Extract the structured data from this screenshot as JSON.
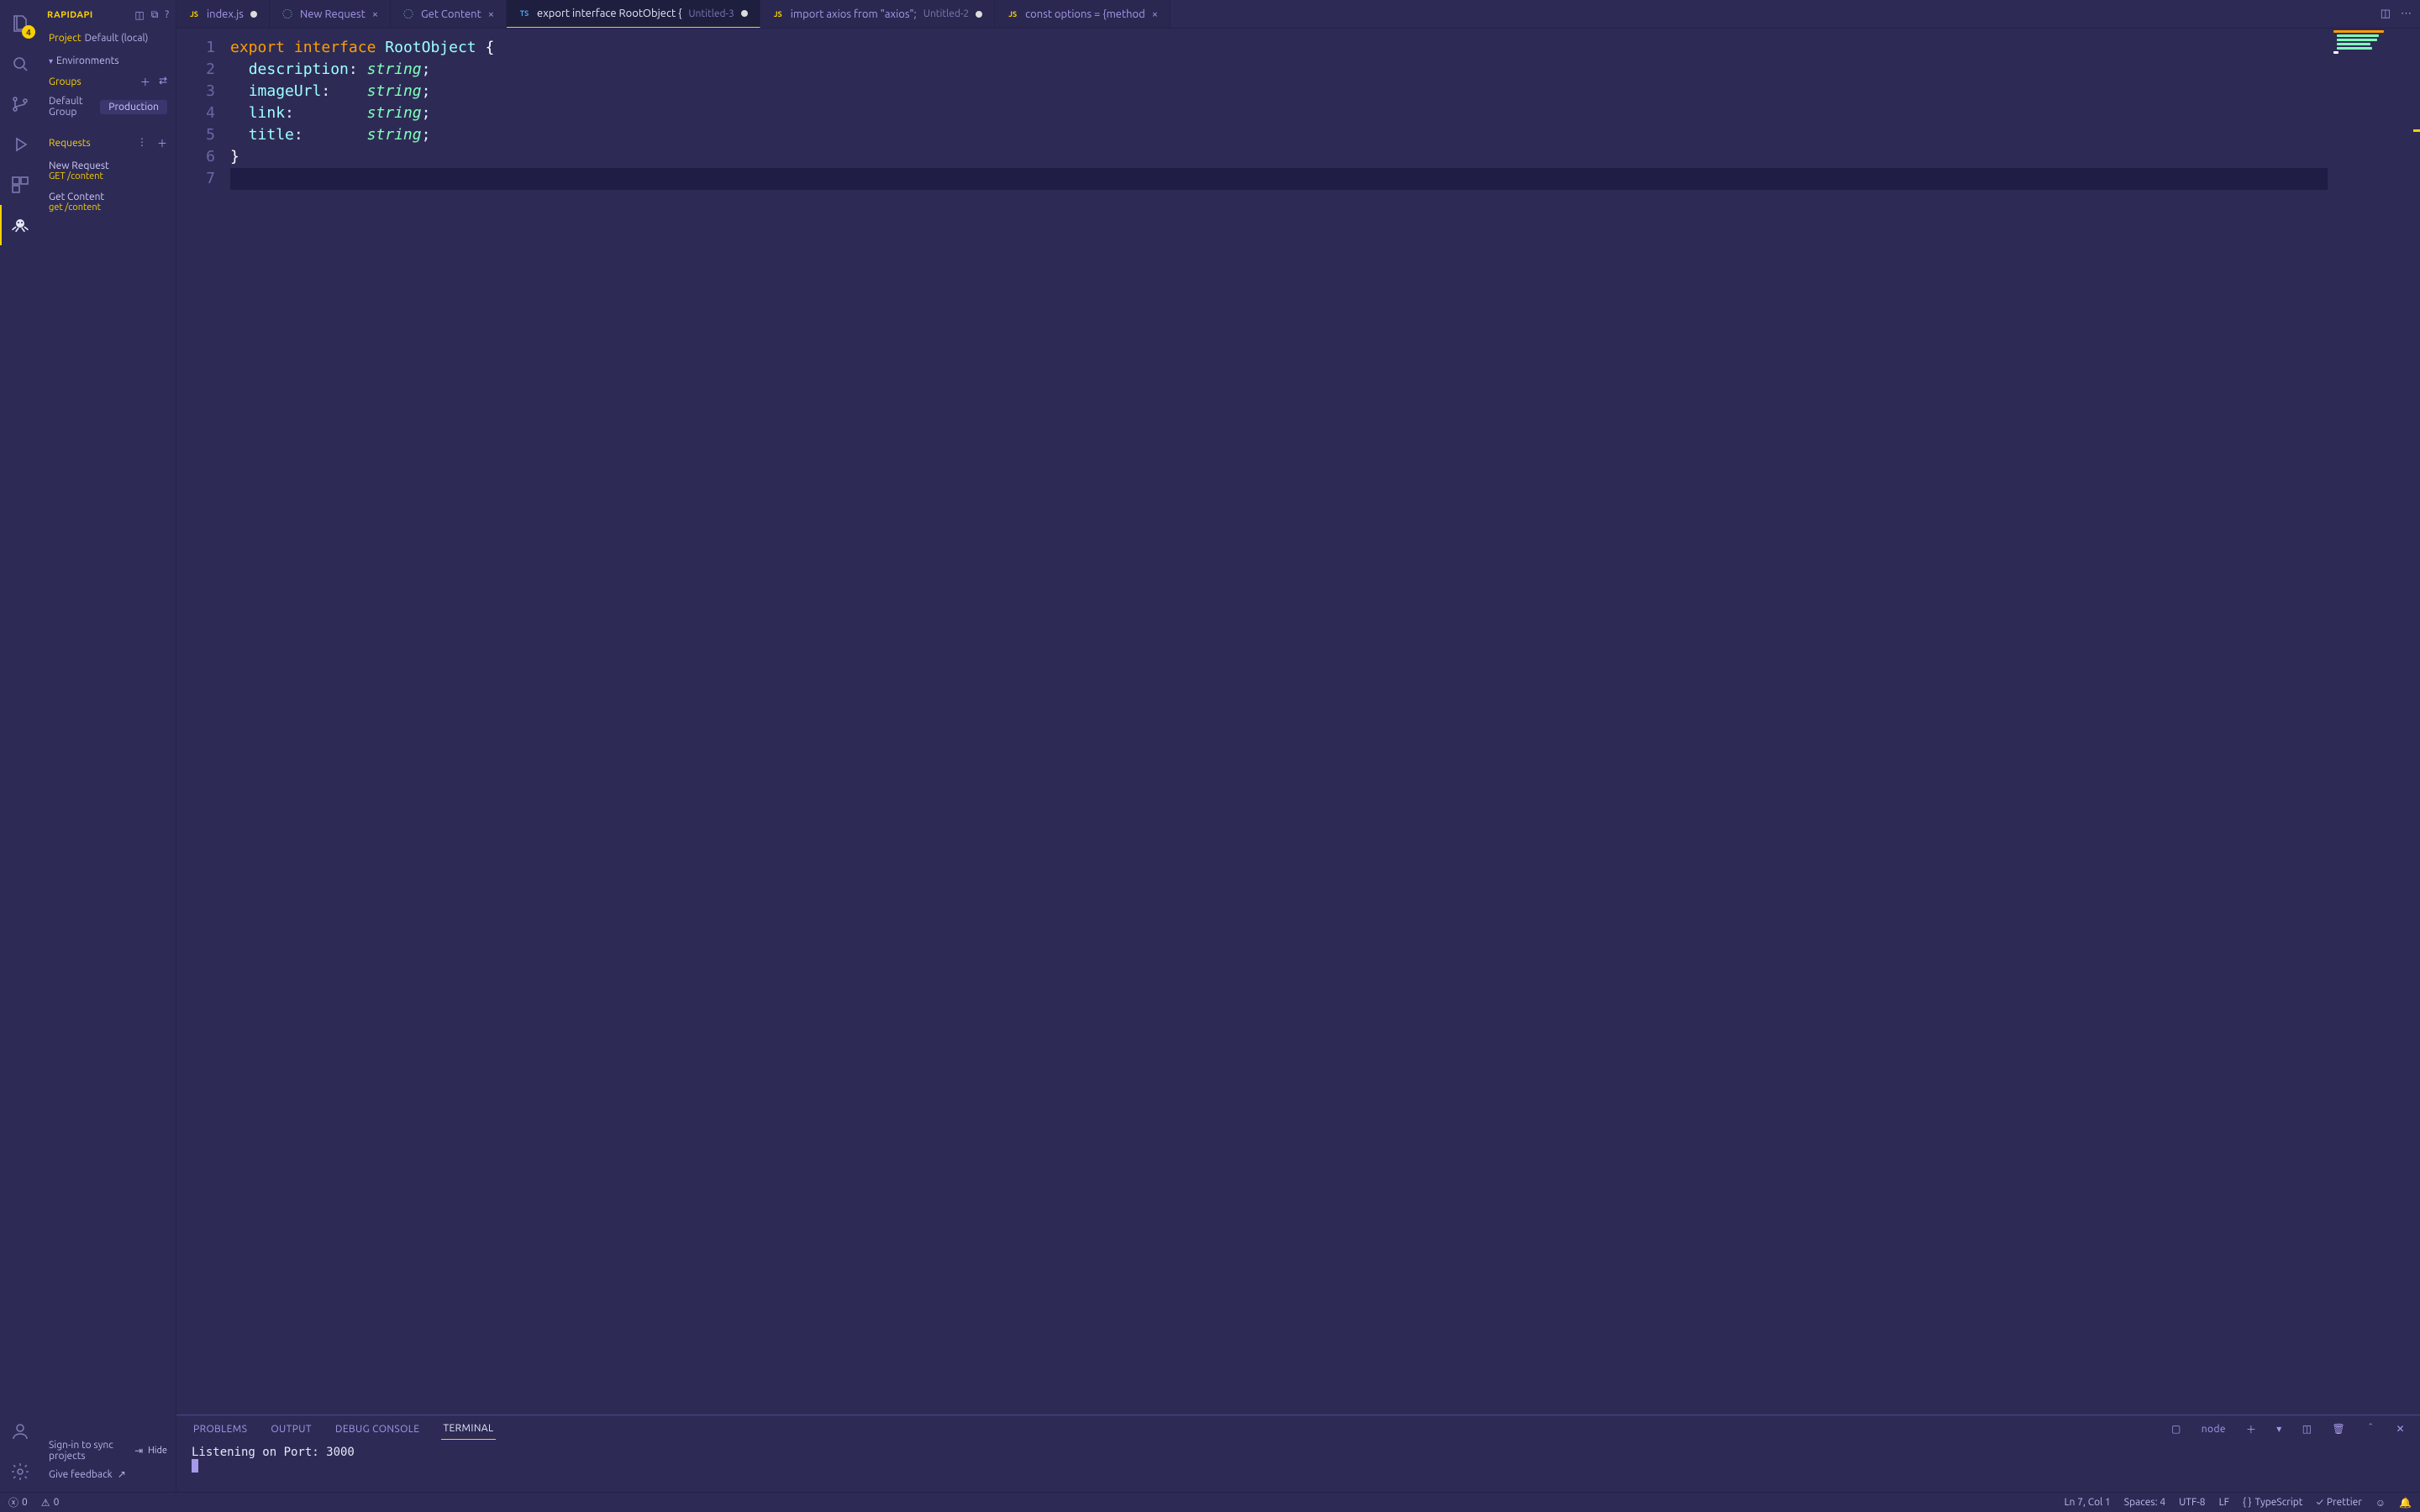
{
  "sidebar": {
    "title": "RAPIDAPI",
    "project_label": "Project",
    "project_name": "Default (local)",
    "environments_label": "Environments",
    "groups_label": "Groups",
    "default_group_label": "Default Group",
    "env_chip": "Production",
    "requests_label": "Requests",
    "requests": [
      {
        "name": "New Request",
        "sub": "GET /content"
      },
      {
        "name": "Get Content",
        "sub": "get /content"
      }
    ],
    "signin_text": "Sign-in to sync projects",
    "hide_label": "Hide",
    "feedback_label": "Give feedback"
  },
  "activity_badge": "4",
  "tabs": [
    {
      "kind": "js",
      "label": "index.js",
      "desc": "",
      "dirty": true
    },
    {
      "kind": "api",
      "label": "New Request",
      "desc": "",
      "dirty": false
    },
    {
      "kind": "api",
      "label": "Get Content",
      "desc": "",
      "dirty": false
    },
    {
      "kind": "ts",
      "label": "export interface RootObject {",
      "desc": "Untitled-3",
      "dirty": true,
      "active": true
    },
    {
      "kind": "js",
      "label": "import axios from \"axios\";",
      "desc": "Untitled-2",
      "dirty": true
    },
    {
      "kind": "js",
      "label": "const options = {method",
      "desc": "",
      "dirty": false
    }
  ],
  "code": {
    "lines": [
      {
        "n": 1,
        "tokens": [
          [
            "kw-export",
            "export"
          ],
          [
            "",
            " "
          ],
          [
            "kw-interface",
            "interface"
          ],
          [
            "",
            " "
          ],
          [
            "typename",
            "RootObject"
          ],
          [
            "",
            " "
          ],
          [
            "brace",
            "{"
          ]
        ]
      },
      {
        "n": 2,
        "tokens": [
          [
            "",
            "  "
          ],
          [
            "prop",
            "description"
          ],
          [
            "colon",
            ":"
          ],
          [
            "",
            " "
          ],
          [
            "type",
            "string"
          ],
          [
            "semi",
            ";"
          ]
        ]
      },
      {
        "n": 3,
        "tokens": [
          [
            "",
            "  "
          ],
          [
            "prop",
            "imageUrl"
          ],
          [
            "colon",
            ":"
          ],
          [
            "",
            "    "
          ],
          [
            "type",
            "string"
          ],
          [
            "semi",
            ";"
          ]
        ]
      },
      {
        "n": 4,
        "tokens": [
          [
            "",
            "  "
          ],
          [
            "prop",
            "link"
          ],
          [
            "colon",
            ":"
          ],
          [
            "",
            "        "
          ],
          [
            "type",
            "string"
          ],
          [
            "semi",
            ";"
          ]
        ]
      },
      {
        "n": 5,
        "tokens": [
          [
            "",
            "  "
          ],
          [
            "prop",
            "title"
          ],
          [
            "colon",
            ":"
          ],
          [
            "",
            "       "
          ],
          [
            "type",
            "string"
          ],
          [
            "semi",
            ";"
          ]
        ]
      },
      {
        "n": 6,
        "tokens": [
          [
            "brace",
            "}"
          ]
        ]
      },
      {
        "n": 7,
        "tokens": [
          [
            "",
            ""
          ]
        ],
        "highlight": true
      }
    ]
  },
  "panel": {
    "tabs": [
      "PROBLEMS",
      "OUTPUT",
      "DEBUG CONSOLE",
      "TERMINAL"
    ],
    "active": "TERMINAL",
    "shell": "node",
    "output": "Listening on Port: 3000"
  },
  "status": {
    "errors": "0",
    "warnings": "0",
    "cursor": "Ln 7, Col 1",
    "spaces": "Spaces: 4",
    "encoding": "UTF-8",
    "eol": "LF",
    "lang": "TypeScript",
    "formatter": "Prettier"
  }
}
